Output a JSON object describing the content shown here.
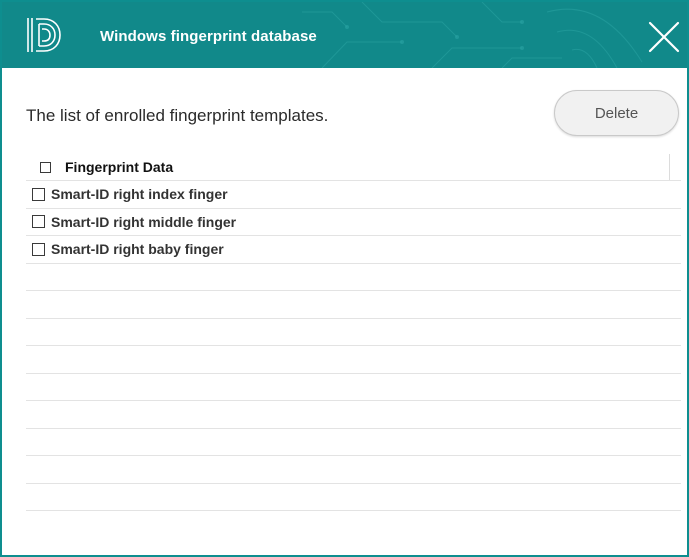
{
  "window": {
    "title": "Windows fingerprint database",
    "accent_color": "#11898a",
    "logo_icon": "id-fingerprint-logo",
    "close_icon": "close-icon"
  },
  "main": {
    "subtitle": "The list of enrolled fingerprint templates.",
    "delete_label": "Delete"
  },
  "table": {
    "header": "Fingerprint Data",
    "rows": [
      {
        "label": "Smart-ID right index finger",
        "checked": false
      },
      {
        "label": "Smart-ID right middle finger",
        "checked": false
      },
      {
        "label": "Smart-ID right baby finger",
        "checked": false
      }
    ]
  }
}
